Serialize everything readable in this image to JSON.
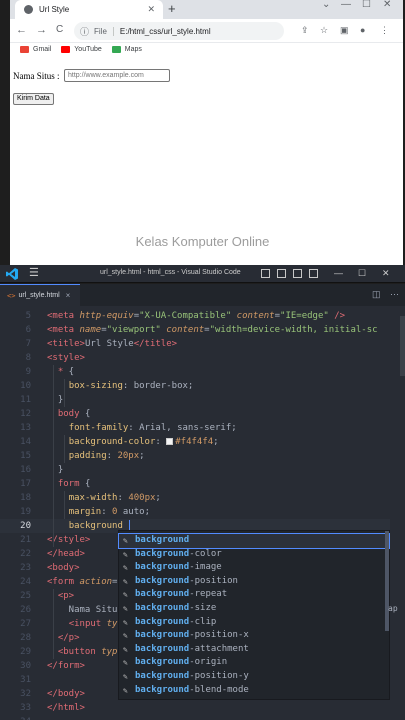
{
  "browser": {
    "tab_title": "Url Style",
    "new_tab_label": "+",
    "minimize": "—",
    "maximize": "☐",
    "close": "✕",
    "back": "←",
    "forward": "→",
    "reload": "C",
    "scheme_label": "File",
    "url": "E:/html_css/url_style.html",
    "bookmarks": [
      {
        "label": "Gmail",
        "color": "#ea4335"
      },
      {
        "label": "YouTube",
        "color": "#ff0000"
      },
      {
        "label": "Maps",
        "color": "#34a853"
      }
    ],
    "page": {
      "label": "Nama Situs :",
      "input_placeholder": "http://www.example.com",
      "submit_label": "Kirim Data"
    }
  },
  "watermark": "Kelas Komputer Online",
  "vscode": {
    "title": "url_style.html - html_css - Visual Studio Code",
    "tab_icon": "<>",
    "tab_label": "url_style.html",
    "tab_close": "×",
    "lines": [
      {
        "n": "5",
        "html": "<span class='tag'>&lt;meta</span> <span class='attr'>http-equiv</span>=<span class='str'>\"X-UA-Compatible\"</span> <span class='attr'>content</span>=<span class='str'>\"IE=edge\"</span> <span class='tag'>/&gt;</span>"
      },
      {
        "n": "6",
        "html": "<span class='tag'>&lt;meta</span> <span class='attr'>name</span>=<span class='str'>\"viewport\"</span> <span class='attr'>content</span>=<span class='str'>\"width=device-width, initial-sc</span>"
      },
      {
        "n": "7",
        "html": "<span class='tag'>&lt;title&gt;</span>Url Style<span class='tag'>&lt;/title&gt;</span>"
      },
      {
        "n": "8",
        "html": "<span class='tag'>&lt;style&gt;</span>"
      },
      {
        "n": "9",
        "html": "  <span class='kw'>*</span> {"
      },
      {
        "n": "10",
        "html": "    <span class='prop'>box-sizing</span>: <span class='val'>border-box</span>;"
      },
      {
        "n": "11",
        "html": "  }"
      },
      {
        "n": "12",
        "html": "  <span class='kw'>body</span> {"
      },
      {
        "n": "13",
        "html": "    <span class='prop'>font-family</span>: <span class='val'>Arial, sans-serif</span>;"
      },
      {
        "n": "14",
        "html": "    <span class='prop'>background-color</span>: <span class='swatch'></span><span class='num'>#f4f4f4</span>;"
      },
      {
        "n": "15",
        "html": "    <span class='prop'>padding</span>: <span class='num'>20px</span>;"
      },
      {
        "n": "16",
        "html": "  }"
      },
      {
        "n": "17",
        "html": "  <span class='kw'>form</span> {"
      },
      {
        "n": "18",
        "html": "    <span class='prop'>max-width</span>: <span class='num'>400px</span>;"
      },
      {
        "n": "19",
        "html": "    <span class='prop'>margin</span>: <span class='num'>0</span> <span class='val'>auto</span>;"
      },
      {
        "n": "20",
        "html": "    <span class='prop'>background</span>"
      },
      {
        "n": "21",
        "html": "<span class='tag'>&lt;/style&gt;</span>"
      },
      {
        "n": "22",
        "html": "<span class='tag'>&lt;/head&gt;</span>"
      },
      {
        "n": "23",
        "html": "<span class='tag'>&lt;body&gt;</span>"
      },
      {
        "n": "24",
        "html": "<span class='tag'>&lt;form</span> <span class='attr'>action</span>="
      },
      {
        "n": "25",
        "html": "  <span class='tag'>&lt;p&gt;</span>"
      },
      {
        "n": "26",
        "html": "    Nama Situ"
      },
      {
        "n": "27",
        "html": "    <span class='tag'>&lt;input</span> <span class='attr'>ty</span>"
      },
      {
        "n": "28",
        "html": "  <span class='tag'>&lt;/p&gt;</span>"
      },
      {
        "n": "29",
        "html": "  <span class='tag'>&lt;button</span> <span class='attr'>typ</span>"
      },
      {
        "n": "30",
        "html": "<span class='tag'>&lt;/form&gt;</span>"
      },
      {
        "n": "31",
        "html": ""
      },
      {
        "n": "32",
        "html": "<span class='tag'>&lt;/body&gt;</span>"
      },
      {
        "n": "33",
        "html": "<span class='tag'>&lt;/html&gt;</span>"
      },
      {
        "n": "34",
        "html": ""
      }
    ],
    "current_line": "20",
    "suggestion_match": "background",
    "suggestions": [
      {
        "rest": ""
      },
      {
        "rest": "-color"
      },
      {
        "rest": "-image"
      },
      {
        "rest": "-position"
      },
      {
        "rest": "-repeat"
      },
      {
        "rest": "-size"
      },
      {
        "rest": "-clip"
      },
      {
        "rest": "-position-x"
      },
      {
        "rest": "-attachment"
      },
      {
        "rest": "-origin"
      },
      {
        "rest": "-position-y"
      },
      {
        "rest": "-blend-mode"
      }
    ],
    "peek_text": "ap"
  }
}
